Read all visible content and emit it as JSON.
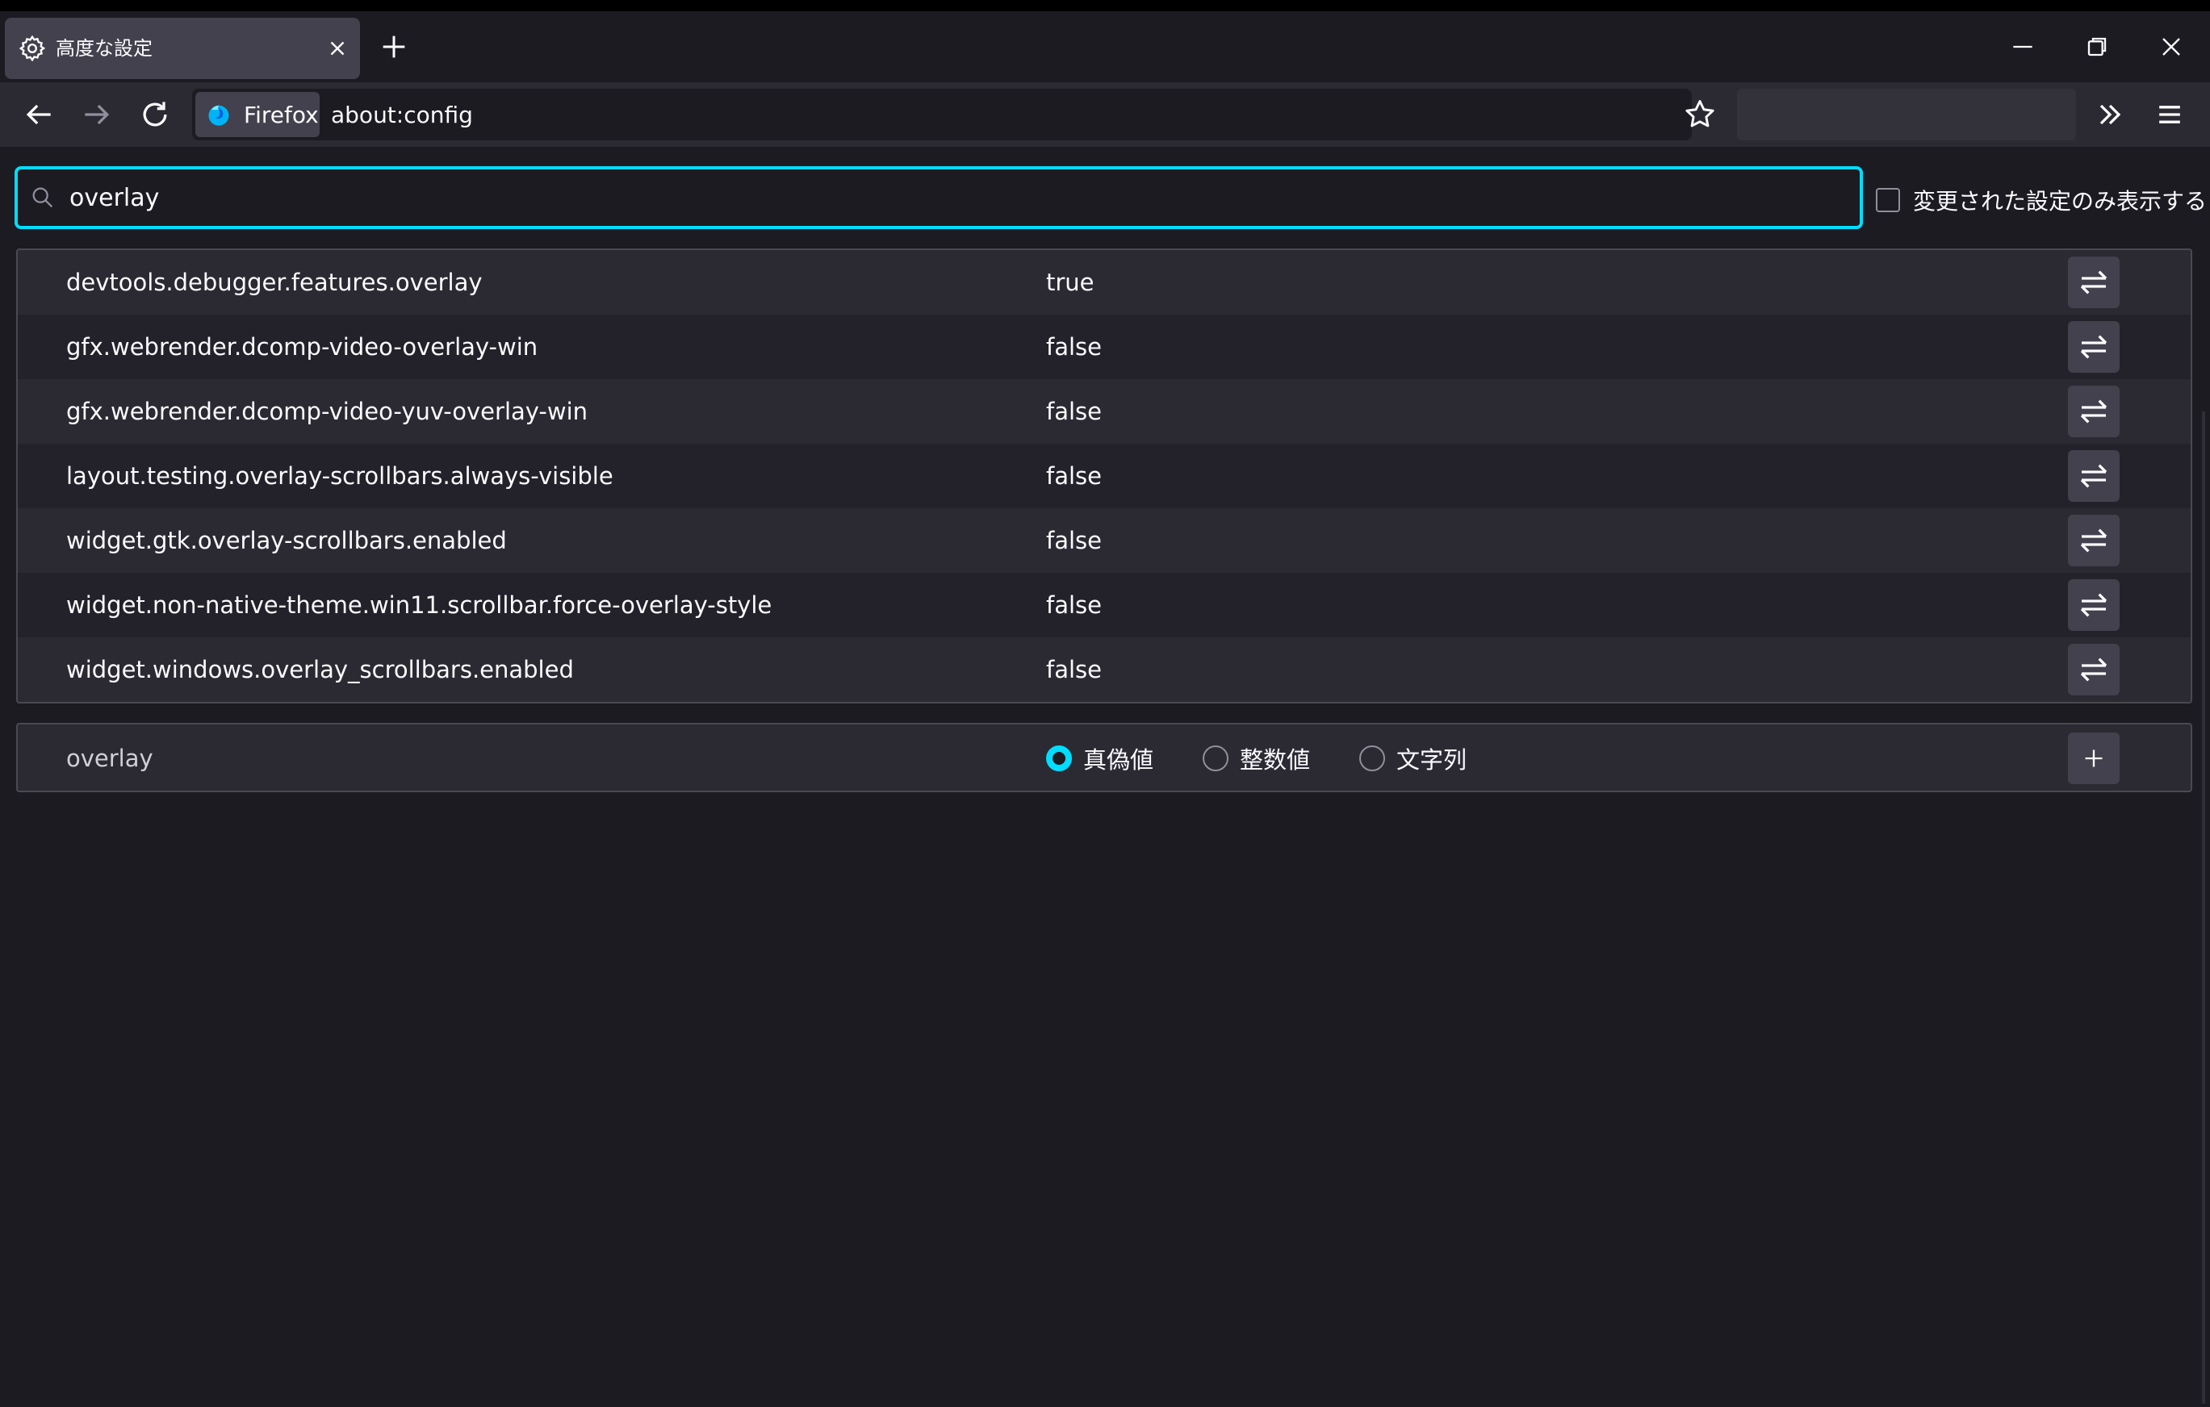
{
  "tab": {
    "title": "高度な設定"
  },
  "urlbar": {
    "identity_label": "Firefox",
    "url": "about:config"
  },
  "search": {
    "value": "overlay"
  },
  "modified_only": {
    "label": "変更された設定のみ表示する",
    "checked": false
  },
  "prefs": [
    {
      "name": "devtools.debugger.features.overlay",
      "value": "true"
    },
    {
      "name": "gfx.webrender.dcomp-video-overlay-win",
      "value": "false"
    },
    {
      "name": "gfx.webrender.dcomp-video-yuv-overlay-win",
      "value": "false"
    },
    {
      "name": "layout.testing.overlay-scrollbars.always-visible",
      "value": "false"
    },
    {
      "name": "widget.gtk.overlay-scrollbars.enabled",
      "value": "false"
    },
    {
      "name": "widget.non-native-theme.win11.scrollbar.force-overlay-style",
      "value": "false"
    },
    {
      "name": "widget.windows.overlay_scrollbars.enabled",
      "value": "false"
    }
  ],
  "add_pref": {
    "name": "overlay",
    "types": [
      {
        "label": "真偽値",
        "checked": true
      },
      {
        "label": "整数値",
        "checked": false
      },
      {
        "label": "文字列",
        "checked": false
      }
    ]
  },
  "colors": {
    "accent": "#00ddff",
    "background": "#1c1b22",
    "toolbar": "#2b2a33"
  }
}
